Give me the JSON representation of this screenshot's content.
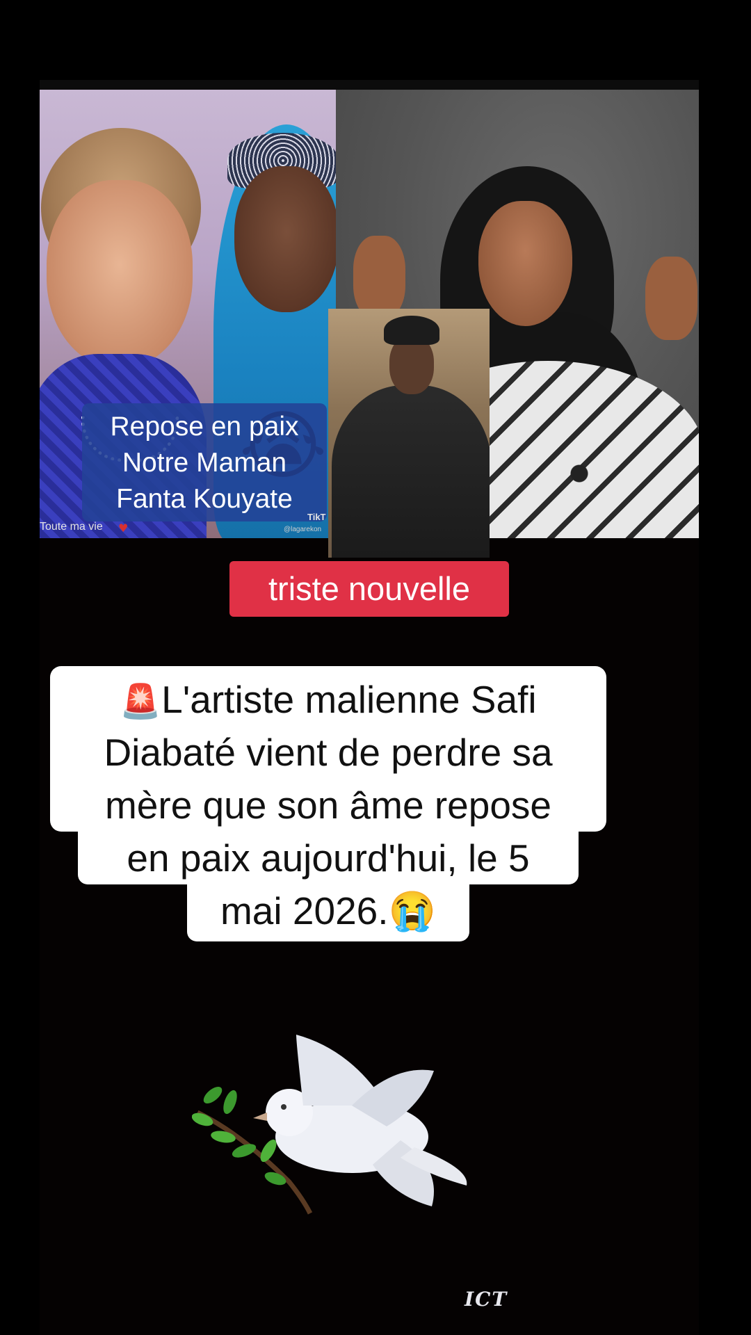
{
  "photos": {
    "left": {
      "caption": "Repose en paix\nNotre Maman\nFanta Kouyate",
      "emoji": "😭",
      "overlay_text": "Toute ma vie",
      "overlay_icon": "heart-icon",
      "tiktok_label": "TikT",
      "tiktok_handle": "@lagarekon"
    },
    "middle": {},
    "right": {}
  },
  "badge": {
    "label": "triste nouvelle",
    "color": "#e03146"
  },
  "caption": {
    "siren": "🚨",
    "line1": "L'artiste malienne Safi",
    "line2": "Diabaté vient de perdre sa",
    "line3": "mère que son âme repose",
    "line4": "en paix aujourd'hui, le 5",
    "line5": "mai 2026.😭"
  },
  "illustration": {
    "icon": "dove-with-olive-branch-icon"
  },
  "watermark": {
    "text": "ICT"
  }
}
